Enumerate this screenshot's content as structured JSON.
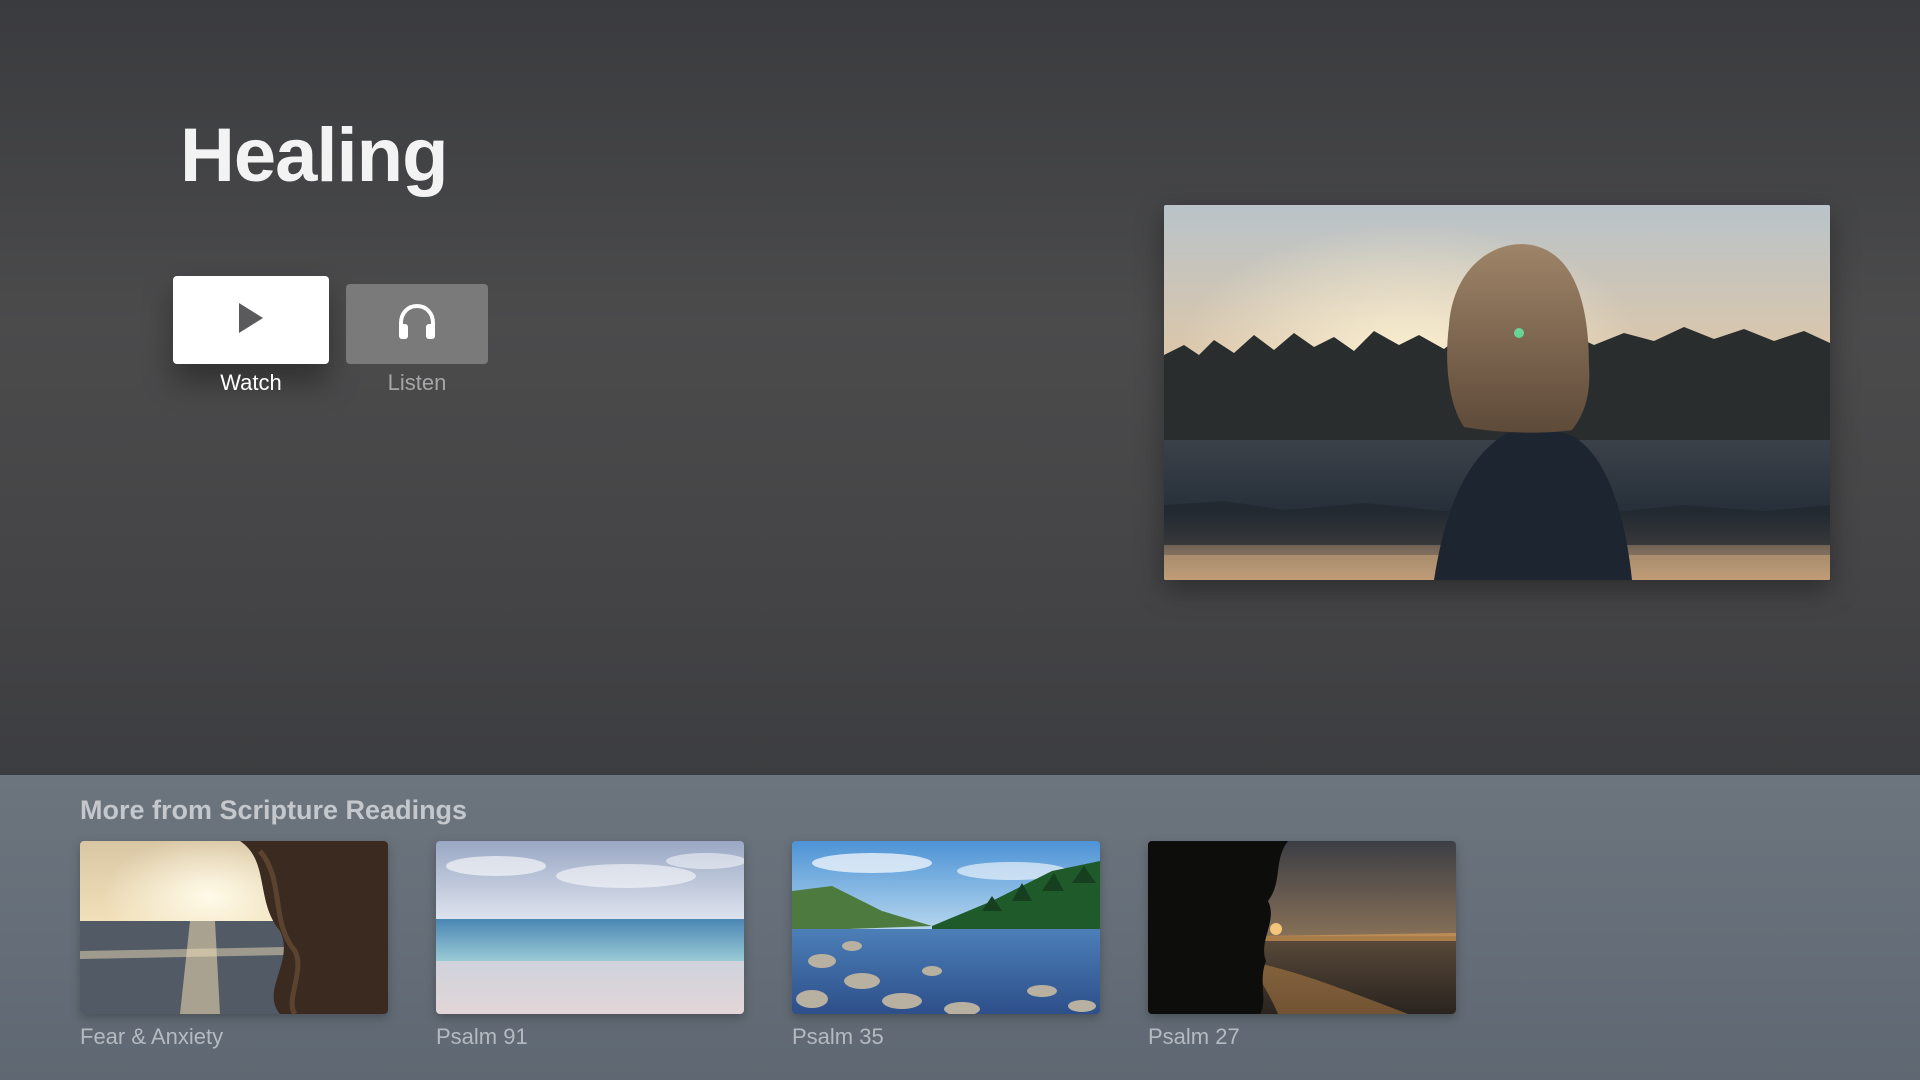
{
  "page": {
    "title": "Healing"
  },
  "actions": {
    "watch": {
      "label": "Watch",
      "icon": "play-icon"
    },
    "listen": {
      "label": "Listen",
      "icon": "headphones-icon"
    }
  },
  "hero_image": {
    "icon": "woman-at-lake-sunset-photo"
  },
  "shelf": {
    "title": "More from Scripture Readings",
    "items": [
      {
        "label": "Fear & Anxiety",
        "icon": "woman-hair-sea-sunset-photo"
      },
      {
        "label": "Psalm 91",
        "icon": "calm-beach-photo"
      },
      {
        "label": "Psalm 35",
        "icon": "mountain-lake-rocks-photo"
      },
      {
        "label": "Psalm 27",
        "icon": "beach-sunset-trees-photo"
      }
    ]
  },
  "colors": {
    "background": "#434345",
    "shelf_background": "#67707a",
    "watch_button": "#ffffff",
    "listen_button": "#7a7a7b"
  }
}
